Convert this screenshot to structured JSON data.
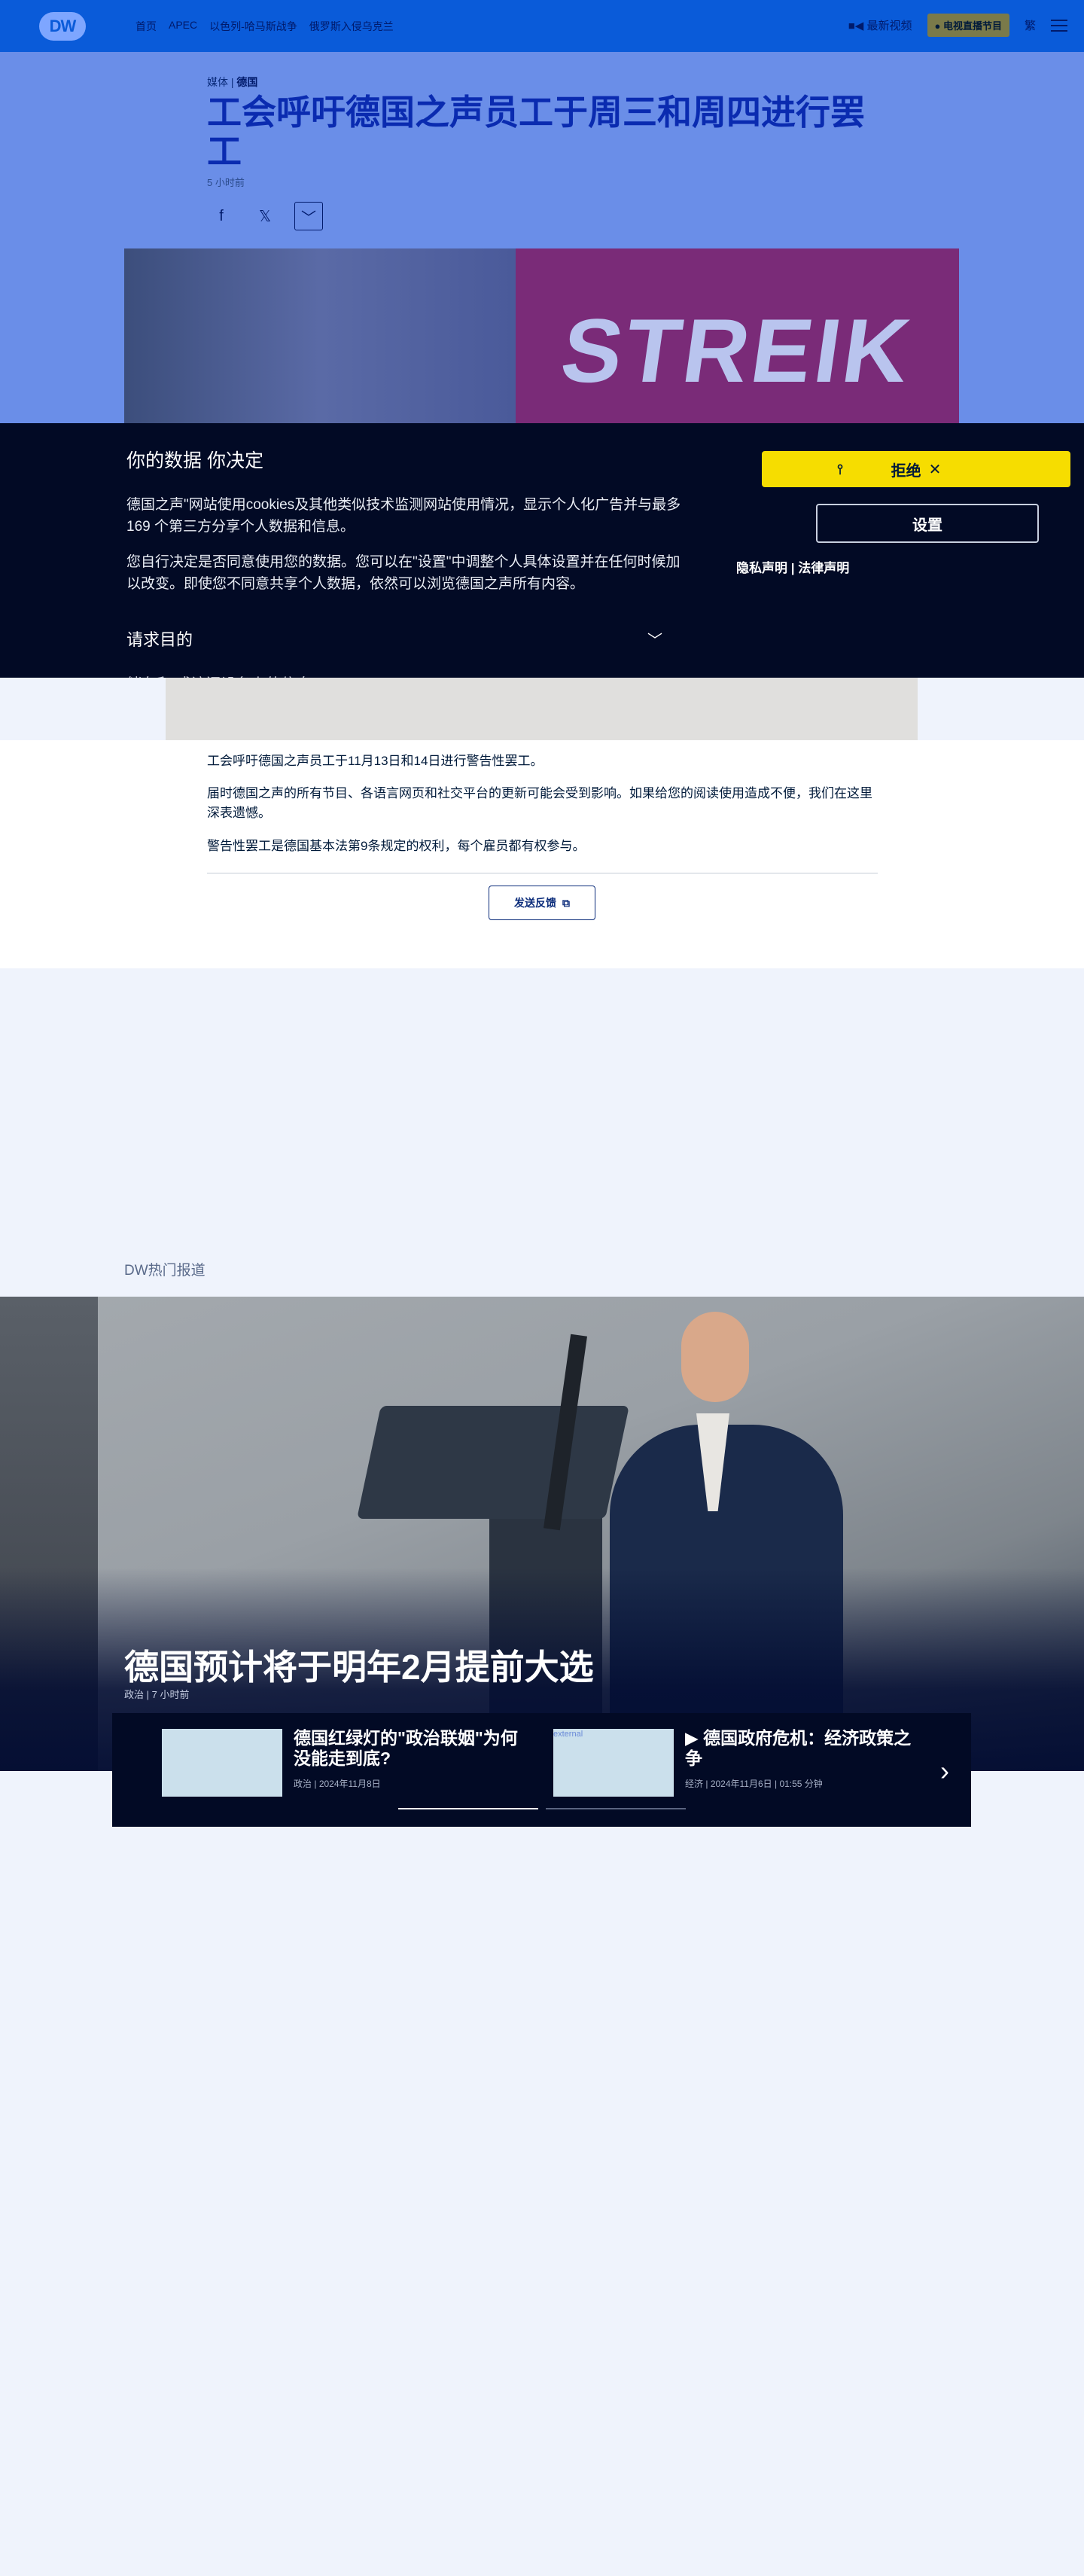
{
  "nav": {
    "logo": "DW",
    "links": [
      "首页",
      "APEC",
      "以色列-哈马斯战争",
      "俄罗斯入侵乌克兰"
    ],
    "latest_video": "最新视频",
    "live_tv": "电视直播节目",
    "language": "繁"
  },
  "article": {
    "category": "媒体",
    "subcategory": "德国",
    "title": "工会呼吁德国之声员工于周三和周四进行罢工",
    "time_ago": "5 小时前",
    "hero_text": "STREIK",
    "paragraphs": [
      "工会呼吁德国之声员工于11月13日和14日进行警告性罢工。",
      "届时德国之声的所有节目、各语言网页和社交平台的更新可能会受到影响。如果给您的阅读使用造成不便，我们在这里深表遗憾。",
      "警告性罢工是德国基本法第9条规定的权利，每个雇员都有权参与。"
    ],
    "feedback": "发送反馈"
  },
  "consent": {
    "title": "你的数据 你决定",
    "p1": "德国之声\"网站使用cookies及其他类似技术监测网站使用情况，显示个人化广告并与最多169 个第三方分享个人数据和信息。",
    "p2": "您自行决定是否同意使用您的数据。您可以在\"设置\"中调整个人具体设置并在任何时候加以改变。即使您不同意共享个人数据，依然可以浏览德国之声所有内容。",
    "purpose": "请求目的",
    "peek": "储存和/或访问设备上的信息",
    "reject": "拒绝",
    "settings": "设置",
    "privacy": "隐私声明",
    "legal": "法律声明"
  },
  "hot": {
    "label": "DW热门报道",
    "featured_title": "德国预计将于明年2月提前大选",
    "featured_category": "政治",
    "featured_time": "7 小时前",
    "cards": [
      {
        "title": "德国红绿灯的\"政治联姻\"为何没能走到底?",
        "category": "政治",
        "date": "2024年11月8日"
      },
      {
        "title": "德国政府危机：经济政策之争",
        "category": "经济",
        "date": "2024年11月6日",
        "duration": "01:55 分钟",
        "alt": "external"
      }
    ]
  },
  "colors": {
    "brand": "#0a5bd9",
    "consent_bg": "#020a25",
    "reject_yellow": "#f6dd00"
  }
}
